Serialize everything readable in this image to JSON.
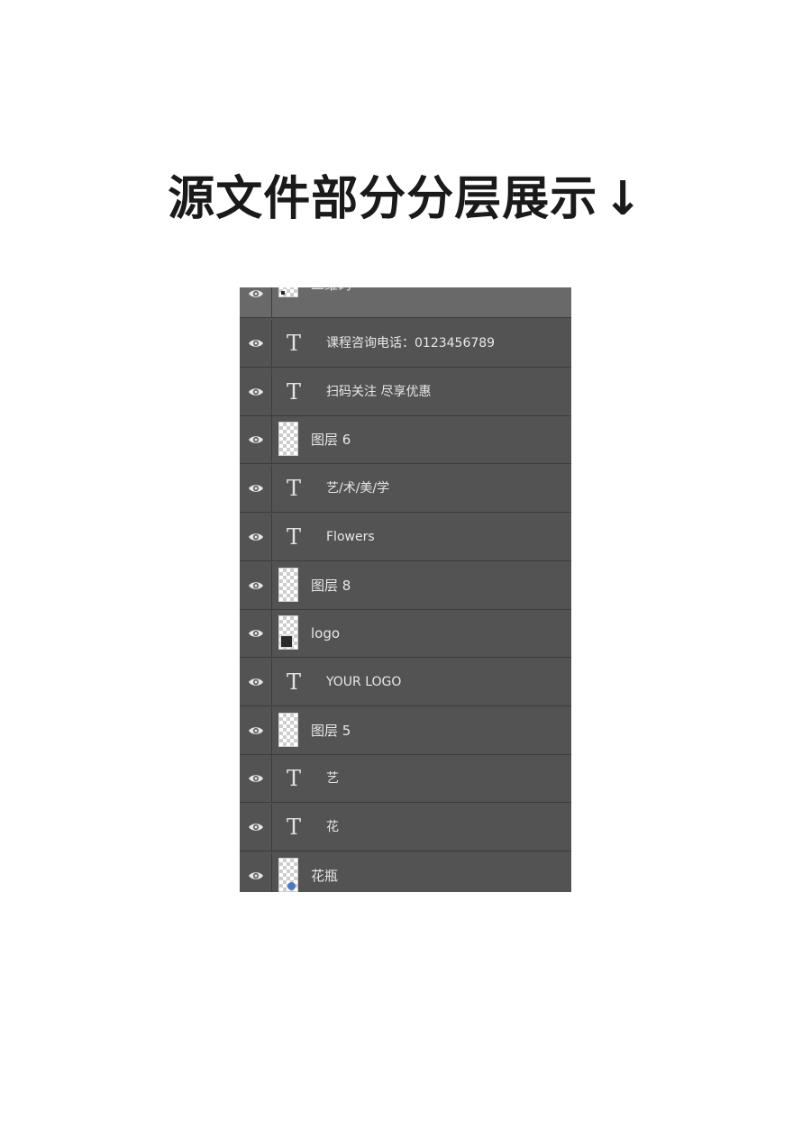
{
  "heading": {
    "title": "源文件部分分层展示",
    "arrow": "↓"
  },
  "colors": {
    "panel_bg": "#535353",
    "selected_bg": "#696969",
    "row_border": "#3c3c3c",
    "text": "#e8e8e8"
  },
  "layers": [
    {
      "name": "二维码",
      "kind": "pixel",
      "thumb": "qr",
      "selected": true,
      "visible": true
    },
    {
      "name": "课程咨询电话：0123456789",
      "kind": "text",
      "visible": true
    },
    {
      "name": "扫码关注 尽享优惠",
      "kind": "text",
      "visible": true
    },
    {
      "name": "图层 6",
      "kind": "pixel",
      "thumb": "blank",
      "visible": true
    },
    {
      "name": "艺/术/美/学",
      "kind": "text",
      "visible": true
    },
    {
      "name": "Flowers",
      "kind": "text",
      "visible": true
    },
    {
      "name": "图层 8",
      "kind": "pixel",
      "thumb": "blank",
      "visible": true
    },
    {
      "name": "logo",
      "kind": "smart-object",
      "thumb": "smart",
      "visible": true
    },
    {
      "name": "YOUR LOGO",
      "kind": "text",
      "visible": true
    },
    {
      "name": "图层 5",
      "kind": "pixel",
      "thumb": "blank",
      "visible": true
    },
    {
      "name": "艺",
      "kind": "text",
      "visible": true
    },
    {
      "name": "花",
      "kind": "text",
      "visible": true
    },
    {
      "name": "花瓶",
      "kind": "pixel",
      "thumb": "vase",
      "visible": true
    }
  ],
  "icons": {
    "visibility": "eye-icon",
    "text_layer": "text-layer-icon",
    "type_glyph": "T"
  }
}
